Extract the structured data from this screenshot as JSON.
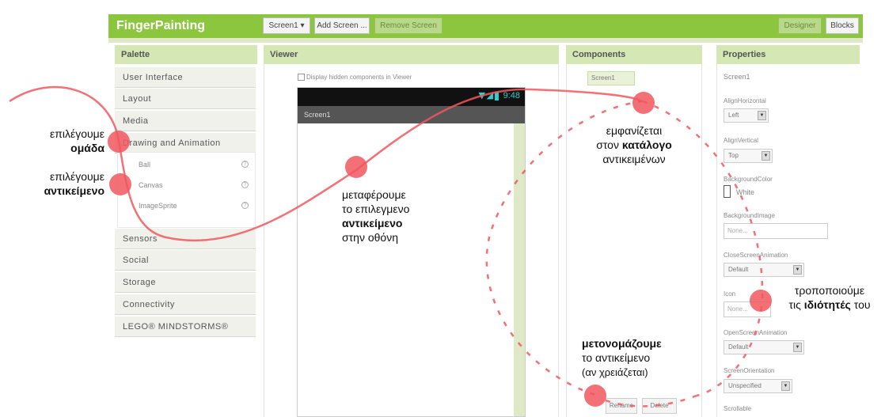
{
  "topbar": {
    "app_title": "FingerPainting",
    "screen_selector": "Screen1 ▾",
    "add_screen": "Add Screen ...",
    "remove_screen": "Remove Screen",
    "designer": "Designer",
    "blocks": "Blocks"
  },
  "palette": {
    "header": "Palette",
    "groups": [
      "User Interface",
      "Layout",
      "Media",
      "Drawing and Animation",
      "Sensors",
      "Social",
      "Storage",
      "Connectivity",
      "LEGO® MINDSTORMS®"
    ],
    "items": [
      "Ball",
      "Canvas",
      "ImageSprite"
    ]
  },
  "viewer": {
    "header": "Viewer",
    "hidden_components_label": "Display hidden components in Viewer",
    "phone_time": "9:48",
    "screen_title": "Screen1"
  },
  "components": {
    "header": "Components",
    "screen_node": "Screen1",
    "rename": "Rename",
    "delete": "Delete"
  },
  "properties": {
    "header": "Properties",
    "component": "Screen1",
    "align_horizontal_label": "AlignHorizontal",
    "align_horizontal_value": "Left",
    "align_vertical_label": "AlignVertical",
    "align_vertical_value": "Top",
    "bg_color_label": "BackgroundColor",
    "bg_color_value": "White",
    "bg_image_label": "BackgroundImage",
    "bg_image_value": "None...",
    "close_anim_label": "CloseScreenAnimation",
    "close_anim_value": "Default",
    "icon_label": "Icon",
    "icon_value": "None...",
    "open_anim_label": "OpenScreenAnimation",
    "open_anim_value": "Default",
    "orientation_label": "ScreenOrientation",
    "orientation_value": "Unspecified",
    "scrollable_label": "Scrollable"
  },
  "annotations": {
    "select_group_1": "επιλέγουμε",
    "select_group_2": "ομάδα",
    "select_object_1": "επιλέγουμε",
    "select_object_2": "αντικείμενο",
    "drag_1": "μεταφέρουμε",
    "drag_2": "το επιλεγμενο",
    "drag_3": "αντικείμενο",
    "drag_4": "στην οθόνη",
    "appears_1": "εμφανίζεται",
    "appears_2a": "στον ",
    "appears_2b": "κατάλογο",
    "appears_3": "αντικειμένων",
    "modify_1": "τροποποιούμε",
    "modify_2a": "τις ",
    "modify_2b": "ιδιότητές",
    "modify_2c": " του",
    "rename_1": "μετονομάζουμε",
    "rename_2": "το αντικείμενο",
    "rename_3": "(αν χρειάζεται)"
  },
  "colors": {
    "topbar": "#8cc63f",
    "panel_header": "#d5e7b4",
    "annotation_red": "#f0575e"
  }
}
